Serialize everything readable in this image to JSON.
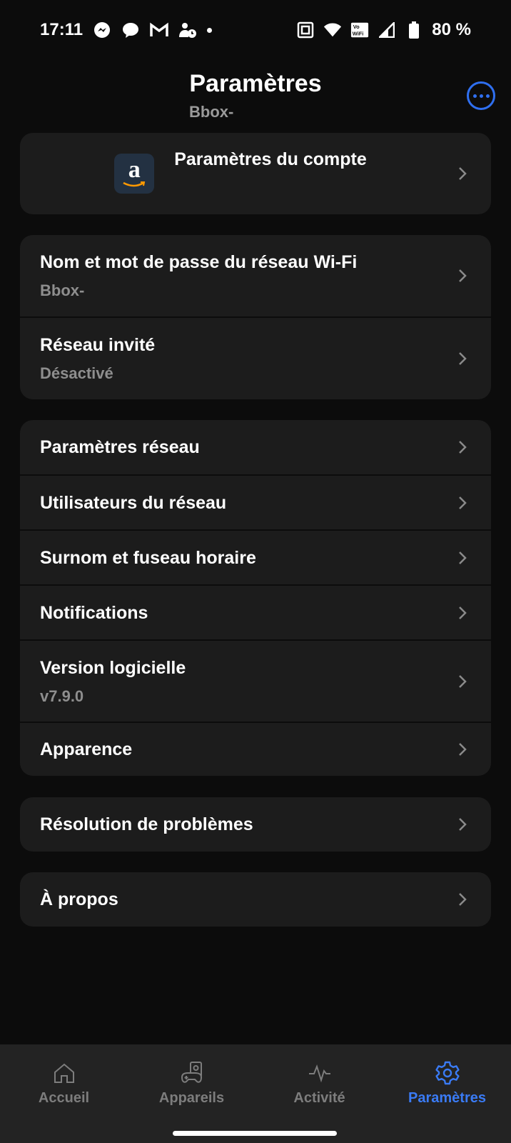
{
  "status_bar": {
    "time": "17:11",
    "battery": "80 %",
    "left_icons": [
      "messenger-icon",
      "chat-icon",
      "gmail-icon",
      "person-clock-icon",
      "dot-icon"
    ],
    "right_icons": [
      "nfc-icon",
      "wifi-icon",
      "vowifi-icon",
      "signal-icon",
      "battery-icon"
    ]
  },
  "header": {
    "title": "Paramètres",
    "subtitle": "Bbox-"
  },
  "sections": {
    "account": {
      "label": "Paramètres du compte",
      "logo_letter": "a"
    },
    "wifi": {
      "name_label": "Nom et mot de passe du réseau Wi-Fi",
      "name_value": "Bbox-",
      "guest_label": "Réseau invité",
      "guest_value": "Désactivé"
    },
    "settings": {
      "network": "Paramètres réseau",
      "users": "Utilisateurs du réseau",
      "nickname": "Surnom et fuseau horaire",
      "notifications": "Notifications",
      "version_label": "Version logicielle",
      "version_value": "v7.9.0",
      "appearance": "Apparence"
    },
    "troubleshooting": {
      "label": "Résolution de problèmes"
    },
    "about": {
      "label": "À propos"
    }
  },
  "bottom_nav": {
    "home": "Accueil",
    "devices": "Appareils",
    "activity": "Activité",
    "settings": "Paramètres",
    "active_color": "#3a7bf5",
    "inactive_color": "#7d7d7d"
  }
}
